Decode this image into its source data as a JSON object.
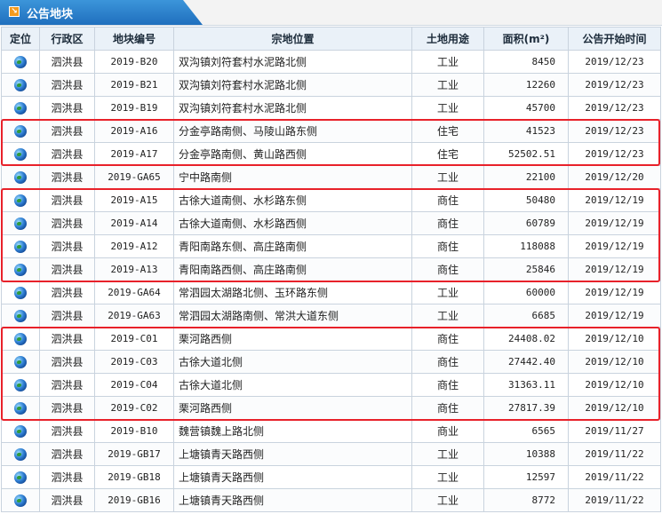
{
  "tab": {
    "title": "公告地块",
    "icon": "arrow-icon"
  },
  "columns": [
    "定位",
    "行政区",
    "地块编号",
    "宗地位置",
    "土地用途",
    "面积(m²)",
    "公告开始时间"
  ],
  "rows": [
    {
      "district": "泗洪县",
      "code": "2019-B20",
      "location": "双沟镇刘符套村水泥路北侧",
      "use": "工业",
      "area": "8450",
      "date": "2019/12/23"
    },
    {
      "district": "泗洪县",
      "code": "2019-B21",
      "location": "双沟镇刘符套村水泥路北侧",
      "use": "工业",
      "area": "12260",
      "date": "2019/12/23"
    },
    {
      "district": "泗洪县",
      "code": "2019-B19",
      "location": "双沟镇刘符套村水泥路北侧",
      "use": "工业",
      "area": "45700",
      "date": "2019/12/23"
    },
    {
      "district": "泗洪县",
      "code": "2019-A16",
      "location": "分金亭路南侧、马陵山路东侧",
      "use": "住宅",
      "area": "41523",
      "date": "2019/12/23"
    },
    {
      "district": "泗洪县",
      "code": "2019-A17",
      "location": "分金亭路南侧、黄山路西侧",
      "use": "住宅",
      "area": "52502.51",
      "date": "2019/12/23"
    },
    {
      "district": "泗洪县",
      "code": "2019-GA65",
      "location": "宁中路南侧",
      "use": "工业",
      "area": "22100",
      "date": "2019/12/20"
    },
    {
      "district": "泗洪县",
      "code": "2019-A15",
      "location": "古徐大道南侧、水杉路东侧",
      "use": "商住",
      "area": "50480",
      "date": "2019/12/19"
    },
    {
      "district": "泗洪县",
      "code": "2019-A14",
      "location": "古徐大道南侧、水杉路西侧",
      "use": "商住",
      "area": "60789",
      "date": "2019/12/19"
    },
    {
      "district": "泗洪县",
      "code": "2019-A12",
      "location": "青阳南路东侧、高庄路南侧",
      "use": "商住",
      "area": "118088",
      "date": "2019/12/19"
    },
    {
      "district": "泗洪县",
      "code": "2019-A13",
      "location": "青阳南路西侧、高庄路南侧",
      "use": "商住",
      "area": "25846",
      "date": "2019/12/19"
    },
    {
      "district": "泗洪县",
      "code": "2019-GA64",
      "location": "常泗园太湖路北侧、玉环路东侧",
      "use": "工业",
      "area": "60000",
      "date": "2019/12/19"
    },
    {
      "district": "泗洪县",
      "code": "2019-GA63",
      "location": "常泗园太湖路南侧、常洪大道东侧",
      "use": "工业",
      "area": "6685",
      "date": "2019/12/19"
    },
    {
      "district": "泗洪县",
      "code": "2019-C01",
      "location": "栗河路西侧",
      "use": "商住",
      "area": "24408.02",
      "date": "2019/12/10"
    },
    {
      "district": "泗洪县",
      "code": "2019-C03",
      "location": "古徐大道北侧",
      "use": "商住",
      "area": "27442.40",
      "date": "2019/12/10"
    },
    {
      "district": "泗洪县",
      "code": "2019-C04",
      "location": "古徐大道北侧",
      "use": "商住",
      "area": "31363.11",
      "date": "2019/12/10"
    },
    {
      "district": "泗洪县",
      "code": "2019-C02",
      "location": "栗河路西侧",
      "use": "商住",
      "area": "27817.39",
      "date": "2019/12/10"
    },
    {
      "district": "泗洪县",
      "code": "2019-B10",
      "location": "魏营镇魏上路北侧",
      "use": "商业",
      "area": "6565",
      "date": "2019/11/27"
    },
    {
      "district": "泗洪县",
      "code": "2019-GB17",
      "location": "上塘镇青天路西侧",
      "use": "工业",
      "area": "10388",
      "date": "2019/11/22"
    },
    {
      "district": "泗洪县",
      "code": "2019-GB18",
      "location": "上塘镇青天路西侧",
      "use": "工业",
      "area": "12597",
      "date": "2019/11/22"
    },
    {
      "district": "泗洪县",
      "code": "2019-GB16",
      "location": "上塘镇青天路西侧",
      "use": "工业",
      "area": "8772",
      "date": "2019/11/22"
    }
  ],
  "highlight_color": "#e8212a",
  "row_icon": "globe-icon"
}
